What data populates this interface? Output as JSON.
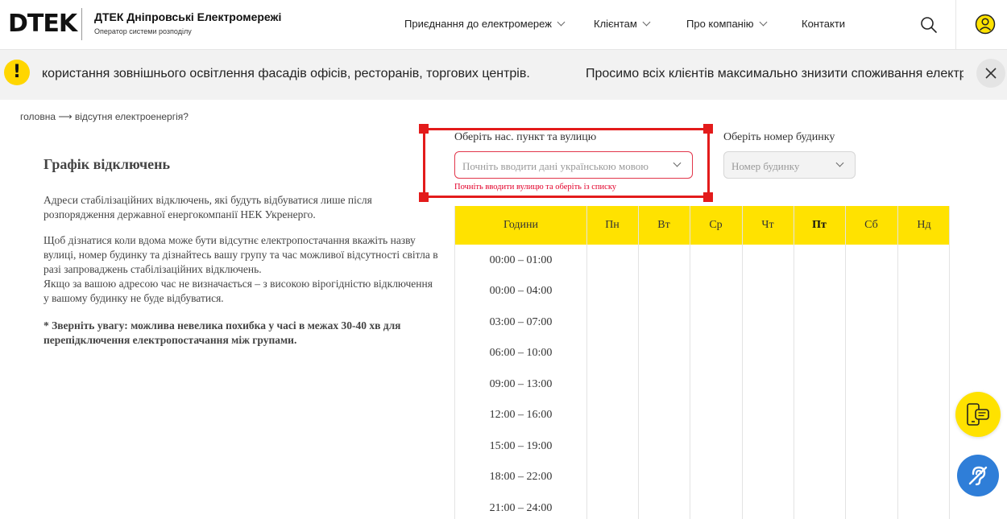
{
  "header": {
    "logo_text": "DTEK",
    "brand_title": "ДТЕК Дніпровські Електромережі",
    "brand_subtitle": "Оператор системи розподілу",
    "nav": [
      {
        "label": "Приєднання до електромереж"
      },
      {
        "label": "Клієнтам"
      },
      {
        "label": "Про компанію"
      },
      {
        "label": "Контакти"
      }
    ],
    "icons": {
      "search": "search-icon",
      "user": "user-icon"
    },
    "accent_color": "#ffe200"
  },
  "alert": {
    "badge": "!",
    "messages": [
      "користання зовнішнього освітлення фасадів офісів, ресторанів, торгових центрів.",
      "Просимо всіх клієнтів максимально знизити споживання електрое"
    ],
    "close_icon": "close-icon"
  },
  "breadcrumb": "головна ⟶ відсутня електроенергія?",
  "content": {
    "title": "Графік відключень",
    "paragraphs": [
      "Адреси стабілізаційних відключень, які будуть відбуватися лише після розпорядження державної енергокомпанії НЕК Укренерго.",
      "Щоб дізнатися коли вдома може бути відсутнє електропостачання вкажіть назву вулиці, номер будинку та дізнайтесь вашу групу та час можливої відсутності світла в разі запроваджень стабілізаційних відключень.",
      "Якщо за вашою адресою час не визначається – з високою вірогідністю відключення у вашому будинку не буде відбуватися."
    ],
    "note": "* Зверніть увагу: можлива невелика похибка у часі в межах 30-40 хв для перепідключення електропостачання між групами."
  },
  "form": {
    "city_label": "Оберіть нас. пункт та вулицю",
    "city_placeholder": "Почніть вводити дані українською мовою",
    "city_error": "Почніть вводити вулицю та оберіть із списку",
    "house_label": "Оберіть номер будинку",
    "house_placeholder": "Номер будинку",
    "error_color": "#e2002a"
  },
  "schedule": {
    "hours_header": "Години",
    "days": [
      "Пн",
      "Вт",
      "Ср",
      "Чт",
      "Пт",
      "Сб",
      "Нд"
    ],
    "today": "Пт",
    "time_slots": [
      "00:00 – 01:00",
      "00:00 – 04:00",
      "03:00 – 07:00",
      "06:00 – 10:00",
      "09:00 – 13:00",
      "12:00 – 16:00",
      "15:00 – 19:00",
      "18:00 – 22:00",
      "21:00 – 24:00"
    ]
  },
  "floating": {
    "chat_icon": "phone-chat-icon",
    "accessibility_icon": "hearing-accessibility-icon"
  }
}
